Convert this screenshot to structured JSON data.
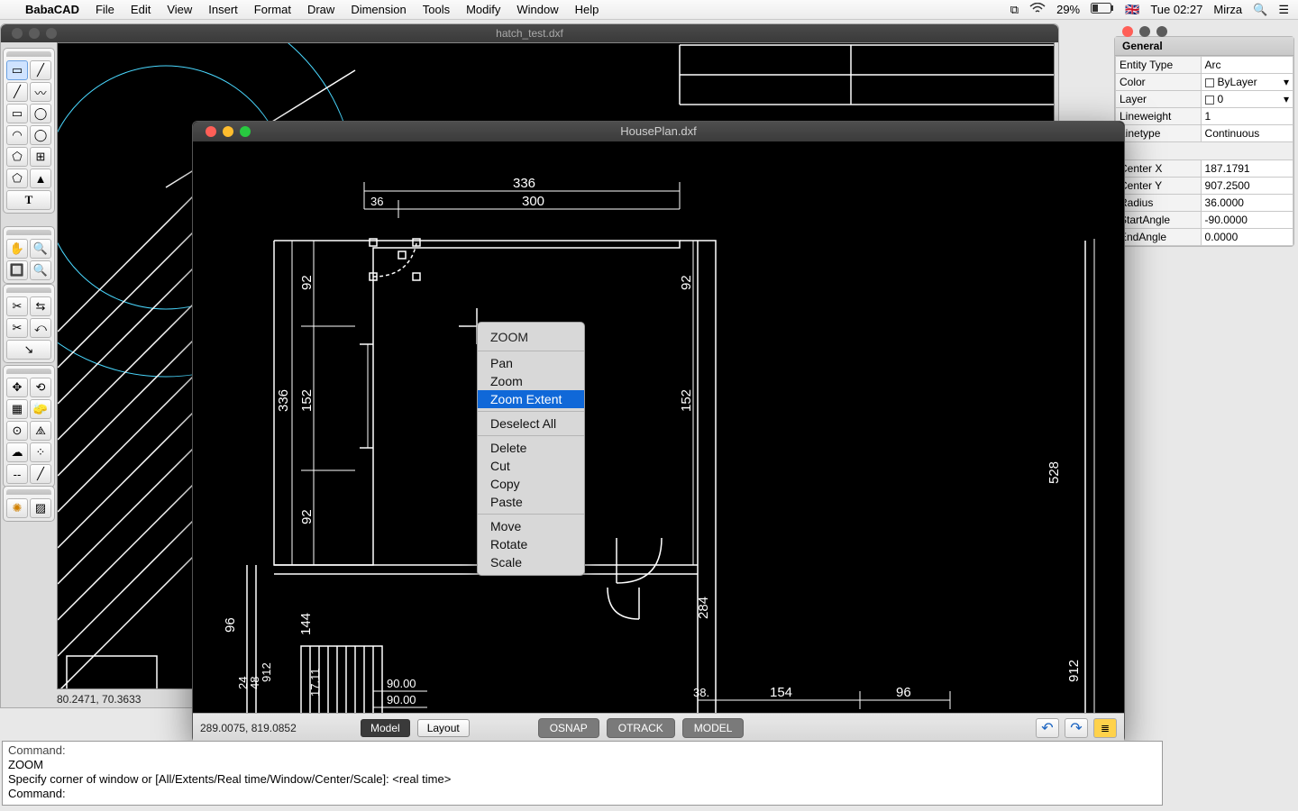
{
  "menubar": {
    "app": "BabaCAD",
    "items": [
      "File",
      "Edit",
      "View",
      "Insert",
      "Format",
      "Draw",
      "Dimension",
      "Tools",
      "Modify",
      "Window",
      "Help"
    ],
    "battery": "29%",
    "clock": "Tue 02:27",
    "user": "Mirza",
    "flag": "🇬🇧"
  },
  "bgdoc": {
    "title": "hatch_test.dxf",
    "status_coord": "80.2471, 70.3633"
  },
  "fgdoc": {
    "title": "HousePlan.dxf",
    "status_coord": "289.0075, 819.0852",
    "tabs": {
      "model": "Model",
      "layout": "Layout"
    },
    "toggles": {
      "osnap": "OSNAP",
      "otrack": "OTRACK",
      "model": "MODEL"
    }
  },
  "context_menu": {
    "header": "ZOOM",
    "g1": [
      "Pan",
      "Zoom",
      "Zoom Extent"
    ],
    "g2": [
      "Deselect All"
    ],
    "g3": [
      "Delete",
      "Cut",
      "Copy",
      "Paste"
    ],
    "g4": [
      "Move",
      "Rotate",
      "Scale"
    ],
    "highlight": "Zoom Extent"
  },
  "properties": {
    "title": "General",
    "rows": [
      {
        "k": "Entity Type",
        "v": "Arc"
      },
      {
        "k": "Color",
        "v": "ByLayer",
        "swatch": true,
        "dd": true
      },
      {
        "k": "Layer",
        "v": "0",
        "swatch": true,
        "dd": true
      },
      {
        "k": "Lineweight",
        "v": "1"
      },
      {
        "k": "Linetype",
        "v": "Continuous"
      }
    ],
    "rows2": [
      {
        "k": "Center X",
        "v": "187.1791"
      },
      {
        "k": "Center Y",
        "v": "907.2500"
      },
      {
        "k": "Radius",
        "v": "36.0000"
      },
      {
        "k": "StartAngle",
        "v": "-90.0000"
      },
      {
        "k": "EndAngle",
        "v": "0.0000"
      }
    ]
  },
  "dimensions": {
    "top_total": "336",
    "top_left": "36",
    "top_right": "300",
    "left_outer": "336",
    "left_inner_top": "92",
    "left_inner_mid": "152",
    "left_inner_bot": "92",
    "right_top": "92",
    "right_mid": "152",
    "right_284": "284",
    "south_90a": "90.00",
    "south_90b": "90.00",
    "south_144": "144",
    "south_96": "96",
    "south_24": "24",
    "south_48": "48",
    "south_912": "912",
    "south_171": "17.11",
    "east_528": "528",
    "east_912": "912",
    "bot_154": "154",
    "bot_96": "96",
    "bot_38": "38."
  },
  "command": {
    "l1": "Command:",
    "l2": "ZOOM",
    "l3": "Specify corner of window or [All/Extents/Real time/Window/Center/Scale]: <real time>",
    "l4": "Command:"
  },
  "tool_icons": {
    "p1": [
      "▭",
      "╱",
      "╱",
      "〰",
      "▭",
      "◯",
      "◠",
      "◯",
      "⬠",
      "⊞",
      "⬠",
      "▲",
      "T"
    ],
    "p2": [
      "✋",
      "🔍",
      "🔲",
      "🔍"
    ],
    "p3": [
      "✂",
      "⇆",
      "✂",
      "⤺",
      "↘"
    ],
    "p4": [
      "✥",
      "⟲",
      "▦",
      "🧽",
      "⊙",
      "⧌",
      "☁",
      "⁘",
      "--",
      "╱"
    ],
    "p5": [
      "✺",
      "▨"
    ]
  }
}
